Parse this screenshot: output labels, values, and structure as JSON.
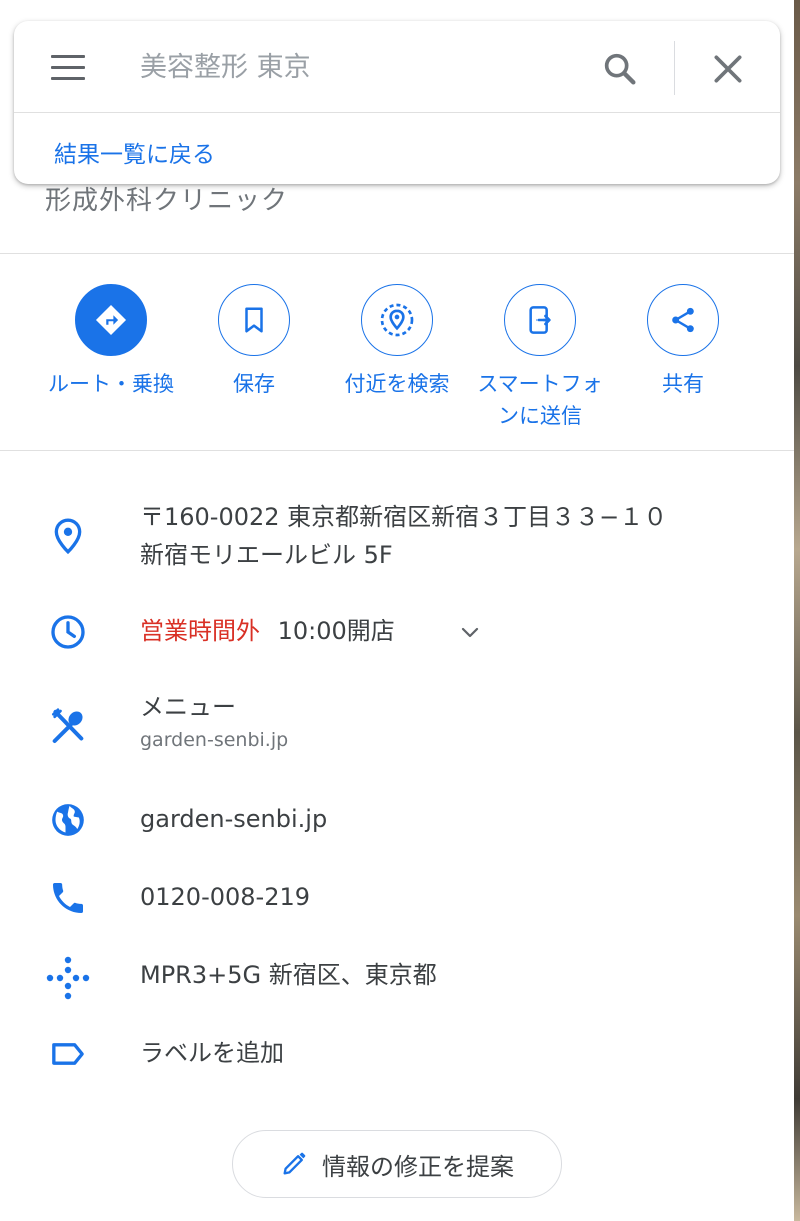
{
  "search": {
    "query": "美容整形 東京",
    "back_label": "結果一覧に戻る"
  },
  "place": {
    "subtitle": "形成外科クリニック"
  },
  "actions": [
    {
      "label": "ルート・乗換",
      "icon": "directions-icon"
    },
    {
      "label": "保存",
      "icon": "bookmark-icon"
    },
    {
      "label": "付近を検索",
      "icon": "nearby-icon"
    },
    {
      "label": "スマートフォンに送信",
      "icon": "send-to-phone-icon"
    },
    {
      "label": "共有",
      "icon": "share-icon"
    }
  ],
  "info": {
    "address_line1": "〒160-0022 東京都新宿区新宿３丁目３３−１０",
    "address_line2": "新宿モリエールビル 5F",
    "hours_status": "営業時間外",
    "hours_open": "10:00開店",
    "menu_title": "メニュー",
    "menu_url": "garden-senbi.jp",
    "website": "garden-senbi.jp",
    "phone": "0120-008-219",
    "plus_code": "MPR3+5G 新宿区、東京都",
    "add_label": "ラベルを追加"
  },
  "suggest_edit": "情報の修正を提案",
  "colors": {
    "accent": "#1a73e8",
    "closed": "#d93025",
    "text": "#3c4043",
    "muted": "#70757a"
  }
}
